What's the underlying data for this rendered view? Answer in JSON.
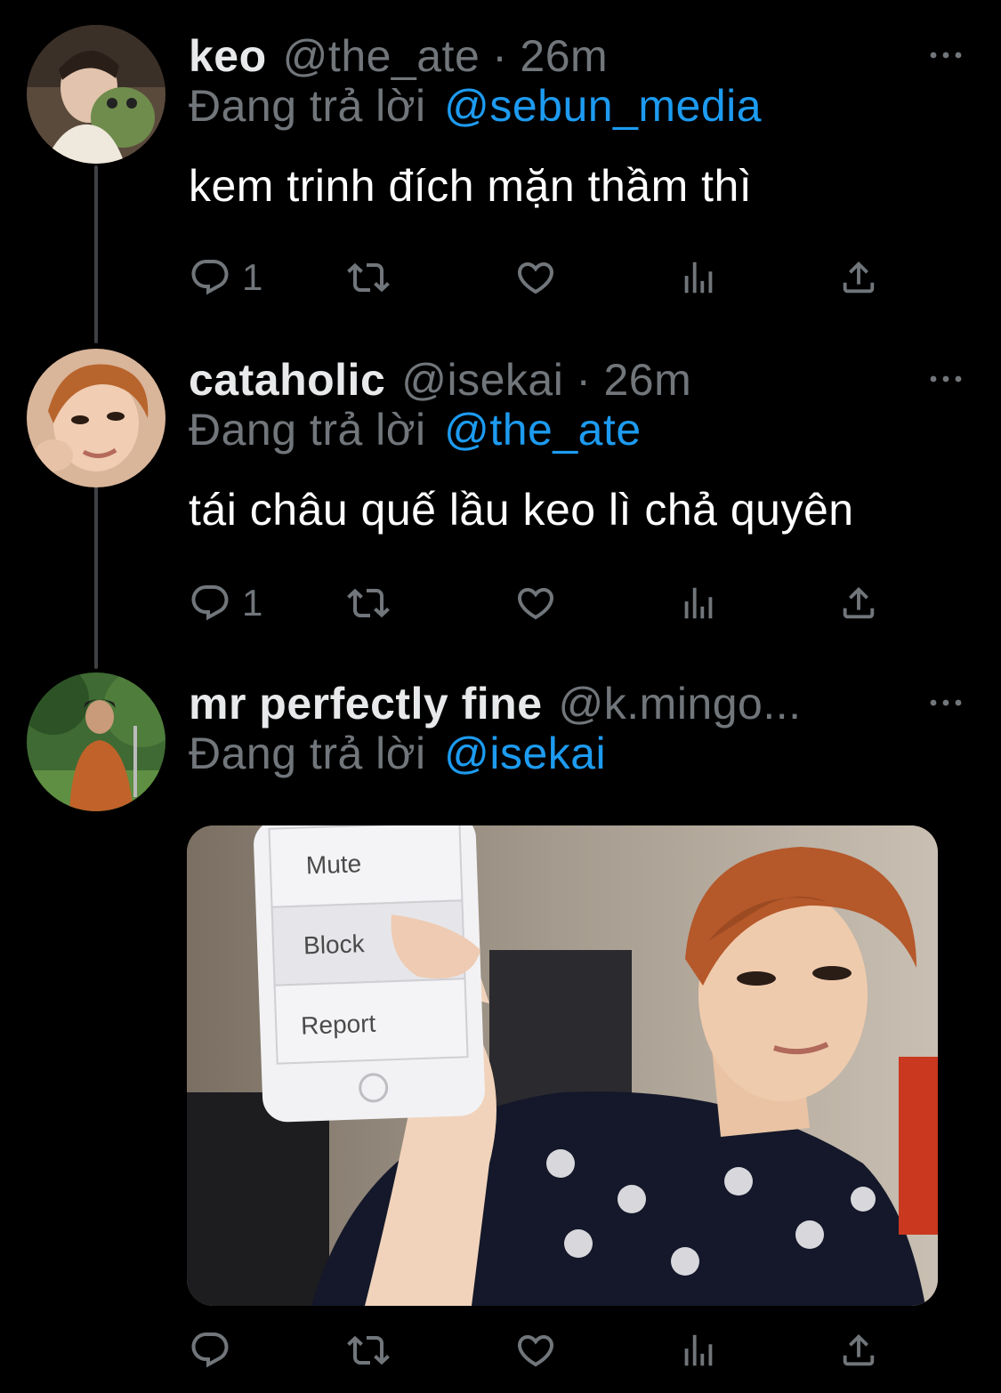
{
  "colors": {
    "background": "#000000",
    "display_name": "#e7e9ea",
    "secondary_text": "#71767b",
    "link": "#1d9bf0",
    "thread_line": "#3e4144"
  },
  "tweets": [
    {
      "display_name": "keo",
      "handle": "@the_ate",
      "separator": "·",
      "time": "26m",
      "replying_prefix": "Đang trả lời",
      "replying_to": "@sebun_media",
      "text": "kem trinh đích mặn thầm thì",
      "reply_count": "1",
      "avatar_icon": "avatar-photo-icon"
    },
    {
      "display_name": "cataholic",
      "handle": "@isekai",
      "separator": "·",
      "time": "26m",
      "replying_prefix": "Đang trả lời",
      "replying_to": "@the_ate",
      "text": "tái châu quế lầu keo lì chả quyên",
      "reply_count": "1",
      "avatar_icon": "avatar-photo-icon"
    },
    {
      "display_name": "mr perfectly fine",
      "handle_truncated": "@k.mingo...",
      "replying_prefix": "Đang trả lời",
      "replying_to": "@isekai",
      "reply_count": "",
      "media": {
        "phone_menu": [
          "Mute",
          "Block",
          "Report"
        ]
      },
      "avatar_icon": "avatar-photo-icon"
    }
  ],
  "action_icons": [
    "reply-icon",
    "retweet-icon",
    "like-icon",
    "views-icon",
    "share-icon"
  ]
}
